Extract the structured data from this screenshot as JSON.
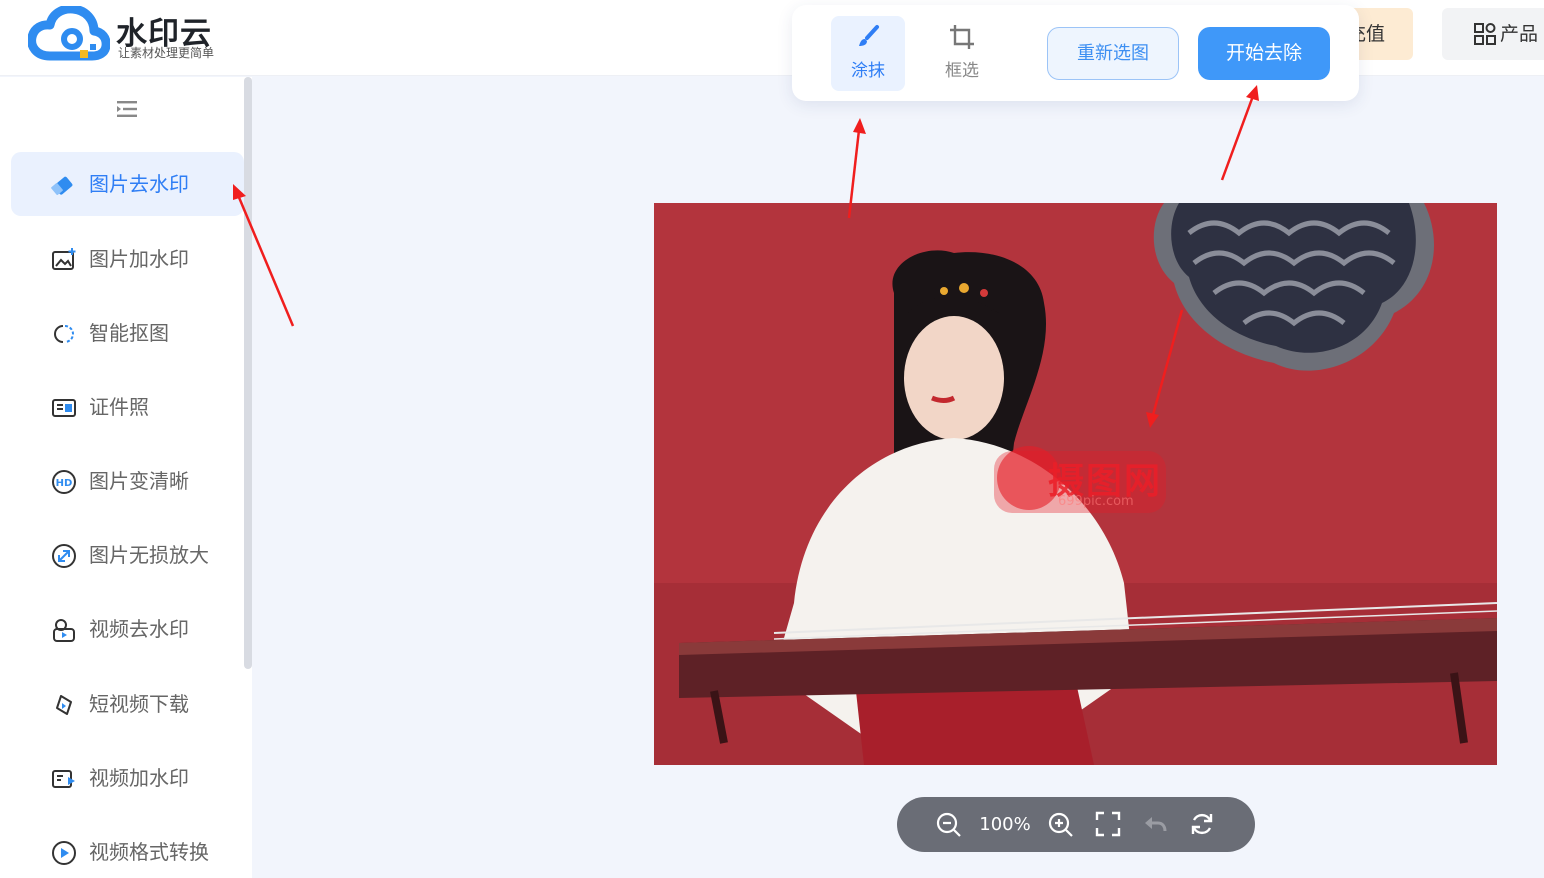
{
  "header": {
    "logo_title": "水印云",
    "logo_subtitle": "让素材处理更简单",
    "recharge_label": "充值",
    "products_label": "产品"
  },
  "toolbar": {
    "tools": [
      {
        "label": "涂抹",
        "icon": "brush-icon",
        "active": true
      },
      {
        "label": "框选",
        "icon": "crop-icon",
        "active": false
      }
    ],
    "reselect_label": "重新选图",
    "start_label": "开始去除"
  },
  "sidebar": {
    "items": [
      {
        "label": "图片去水印",
        "icon": "eraser-icon",
        "active": true
      },
      {
        "label": "图片加水印",
        "icon": "image-add-icon"
      },
      {
        "label": "智能抠图",
        "icon": "cutout-icon"
      },
      {
        "label": "证件照",
        "icon": "id-card-icon"
      },
      {
        "label": "图片变清晰",
        "icon": "hd-icon"
      },
      {
        "label": "图片无损放大",
        "icon": "enlarge-icon"
      },
      {
        "label": "视频去水印",
        "icon": "video-eraser-icon"
      },
      {
        "label": "短视频下载",
        "icon": "download-link-icon"
      },
      {
        "label": "视频加水印",
        "icon": "video-add-icon"
      },
      {
        "label": "视频格式转换",
        "icon": "play-circle-icon"
      }
    ]
  },
  "canvas": {
    "watermark_text": "摄图网",
    "watermark_url": "699pic.com"
  },
  "zoom": {
    "value": "100%"
  },
  "colors": {
    "accent": "#3f98f9",
    "background": "#f2f5fc",
    "photo_red": "#b3343d"
  }
}
